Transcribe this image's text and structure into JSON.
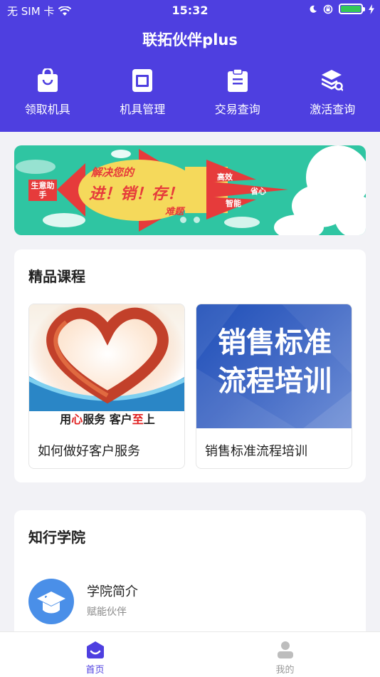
{
  "status_bar": {
    "carrier": "无 SIM 卡",
    "time": "15:32"
  },
  "header": {
    "title": "联拓伙伴plus",
    "background_color": "#4e3fe0"
  },
  "nav": [
    {
      "label": "领取机具",
      "icon": "shopping-bag-icon"
    },
    {
      "label": "机具管理",
      "icon": "device-icon"
    },
    {
      "label": "交易查询",
      "icon": "clipboard-icon"
    },
    {
      "label": "激活查询",
      "icon": "layers-search-icon"
    }
  ],
  "banner": {
    "tag": "生意助手",
    "headline_top": "解决您的",
    "headline_main": "进！销！存！",
    "headline_sub": "难题",
    "tags": [
      "高效",
      "省心",
      "智能"
    ],
    "slide_count": 2,
    "active_slide": 1
  },
  "courses": {
    "title": "精品课程",
    "items": [
      {
        "name": "如何做好客户服务",
        "image_caption_parts": [
          "用",
          "心",
          "服务 客户",
          "至",
          "上"
        ]
      },
      {
        "name": "销售标准流程培训",
        "image_text_lines": [
          "销售标准",
          "流程培训"
        ]
      }
    ]
  },
  "academy": {
    "title": "知行学院",
    "items": [
      {
        "title": "学院简介",
        "subtitle": "赋能伙伴",
        "icon": "graduation-cap-icon"
      }
    ]
  },
  "tabbar": {
    "tabs": [
      {
        "label": "首页",
        "icon": "home-icon",
        "active": true
      },
      {
        "label": "我的",
        "icon": "user-icon",
        "active": false
      }
    ],
    "active_color": "#4e3fe0"
  }
}
